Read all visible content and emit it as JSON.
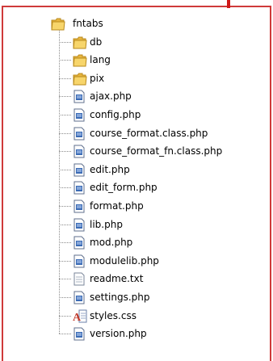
{
  "root": {
    "name": "fntabs",
    "icon": "folder-open-icon"
  },
  "children": [
    {
      "name": "db",
      "type": "folder",
      "icon": "folder-icon"
    },
    {
      "name": "lang",
      "type": "folder",
      "icon": "folder-icon"
    },
    {
      "name": "pix",
      "type": "folder",
      "icon": "folder-icon"
    },
    {
      "name": "ajax.php",
      "type": "file",
      "icon": "php-file-icon"
    },
    {
      "name": "config.php",
      "type": "file",
      "icon": "php-file-icon"
    },
    {
      "name": "course_format.class.php",
      "type": "file",
      "icon": "php-file-icon"
    },
    {
      "name": "course_format_fn.class.php",
      "type": "file",
      "icon": "php-file-icon"
    },
    {
      "name": "edit.php",
      "type": "file",
      "icon": "php-file-icon"
    },
    {
      "name": "edit_form.php",
      "type": "file",
      "icon": "php-file-icon"
    },
    {
      "name": "format.php",
      "type": "file",
      "icon": "php-file-icon"
    },
    {
      "name": "lib.php",
      "type": "file",
      "icon": "php-file-icon"
    },
    {
      "name": "mod.php",
      "type": "file",
      "icon": "php-file-icon"
    },
    {
      "name": "modulelib.php",
      "type": "file",
      "icon": "php-file-icon"
    },
    {
      "name": "readme.txt",
      "type": "file",
      "icon": "text-file-icon"
    },
    {
      "name": "settings.php",
      "type": "file",
      "icon": "php-file-icon"
    },
    {
      "name": "styles.css",
      "type": "file",
      "icon": "css-file-icon"
    },
    {
      "name": "version.php",
      "type": "file",
      "icon": "php-file-icon"
    }
  ],
  "colors": {
    "frame": "#cf3a3a",
    "folder": "#f2c94c",
    "file_blue": "#3b6bb5",
    "css_red": "#c0392b"
  }
}
